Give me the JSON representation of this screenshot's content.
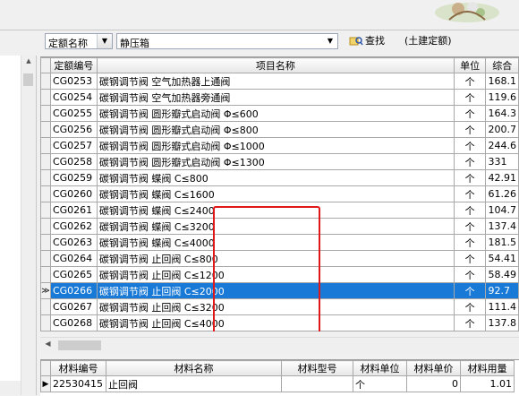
{
  "toolbar": {
    "quota_select": "定额名称",
    "search_value": "静压箱",
    "find_label": "查找",
    "civil_label": "(土建定额)"
  },
  "grid": {
    "headers": [
      "定额编号",
      "项目名称",
      "单位",
      "综合"
    ],
    "rows": [
      {
        "code": "CG0253",
        "name": "碳钢调节阀 空气加热器上通阀",
        "unit": "个",
        "price": "168.1"
      },
      {
        "code": "CG0254",
        "name": "碳钢调节阀 空气加热器旁通阀",
        "unit": "个",
        "price": "119.6"
      },
      {
        "code": "CG0255",
        "name": "碳钢调节阀 圆形瓣式启动阀 Φ≤600",
        "unit": "个",
        "price": "164.3"
      },
      {
        "code": "CG0256",
        "name": "碳钢调节阀 圆形瓣式启动阀 Φ≤800",
        "unit": "个",
        "price": "200.7"
      },
      {
        "code": "CG0257",
        "name": "碳钢调节阀 圆形瓣式启动阀 Φ≤1000",
        "unit": "个",
        "price": "244.6"
      },
      {
        "code": "CG0258",
        "name": "碳钢调节阀 圆形瓣式启动阀 Φ≤1300",
        "unit": "个",
        "price": "331"
      },
      {
        "code": "CG0259",
        "name": "碳钢调节阀 蝶阀 C≤800",
        "unit": "个",
        "price": "42.91"
      },
      {
        "code": "CG0260",
        "name": "碳钢调节阀 蝶阀 C≤1600",
        "unit": "个",
        "price": "61.26"
      },
      {
        "code": "CG0261",
        "name": "碳钢调节阀 蝶阀 C≤2400",
        "unit": "个",
        "price": "104.7"
      },
      {
        "code": "CG0262",
        "name": "碳钢调节阀 蝶阀 C≤3200",
        "unit": "个",
        "price": "137.4"
      },
      {
        "code": "CG0263",
        "name": "碳钢调节阀 蝶阀 C≤4000",
        "unit": "个",
        "price": "181.5"
      },
      {
        "code": "CG0264",
        "name": "碳钢调节阀 止回阀 C≤800",
        "unit": "个",
        "price": "54.41"
      },
      {
        "code": "CG0265",
        "name": "碳钢调节阀 止回阀 C≤1200",
        "unit": "个",
        "price": "58.49"
      },
      {
        "code": "CG0266",
        "name": "碳钢调节阀 止回阀 C≤2000",
        "unit": "个",
        "price": "92.7"
      },
      {
        "code": "CG0267",
        "name": "碳钢调节阀 止回阀 C≤3200",
        "unit": "个",
        "price": "111.4"
      },
      {
        "code": "CG0268",
        "name": "碳钢调节阀 止回阀 C≤4000",
        "unit": "个",
        "price": "137.8"
      }
    ],
    "selected_index": 13,
    "row_marker": "≫"
  },
  "materials": {
    "headers": [
      "材料编号",
      "材料名称",
      "材料型号",
      "材料单位",
      "材料单价",
      "材料用量"
    ],
    "row": {
      "code": "22530415",
      "name": "止回阀",
      "model": "",
      "unit": "个",
      "price": "0",
      "qty": "1.01"
    },
    "row_marker": "▶"
  },
  "colors": {
    "selection": "#1979d6",
    "highlight_box": "#e0181a"
  }
}
